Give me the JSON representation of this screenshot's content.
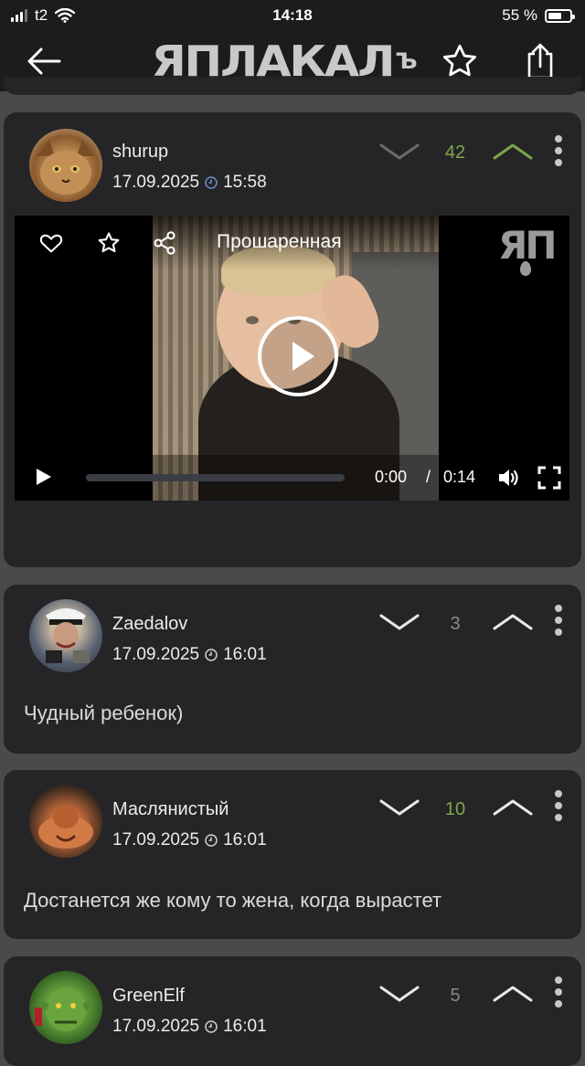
{
  "status": {
    "carrier": "t2",
    "time": "14:18",
    "battery": "55 %"
  },
  "header": {
    "logo_text": "ЯПЛАКАЛ",
    "logo_suffix": "Ъ"
  },
  "video": {
    "title": "Прошаренная",
    "current_time": "0:00",
    "separator": "/",
    "duration": "0:14",
    "logo_text": "ЯП"
  },
  "comments": [
    {
      "username": "shurup",
      "date": "17.09.2025",
      "time": "15:58",
      "votes": "42",
      "vote_color": "#7ea74b",
      "text": ""
    },
    {
      "username": "Zaedalov",
      "date": "17.09.2025",
      "time": "16:01",
      "votes": "3",
      "vote_color": "#8a8a8e",
      "text": "Чудный ребенок)"
    },
    {
      "username": "Маслянистый",
      "date": "17.09.2025",
      "time": "16:01",
      "votes": "10",
      "vote_color": "#7ea74b",
      "text": "Достанется же кому то жена, когда вырастет"
    },
    {
      "username": "GreenElf",
      "date": "17.09.2025",
      "time": "16:01",
      "votes": "5",
      "vote_color": "#8a8a8e",
      "text": ""
    }
  ],
  "icons": {
    "back": "arrow-left-icon",
    "favorite": "star-icon",
    "share": "share-icon",
    "like": "heart-icon",
    "vote_down": "chevron-down-icon",
    "vote_up": "chevron-up-icon",
    "more": "more-vertical-icon",
    "clock": "clock-icon"
  }
}
